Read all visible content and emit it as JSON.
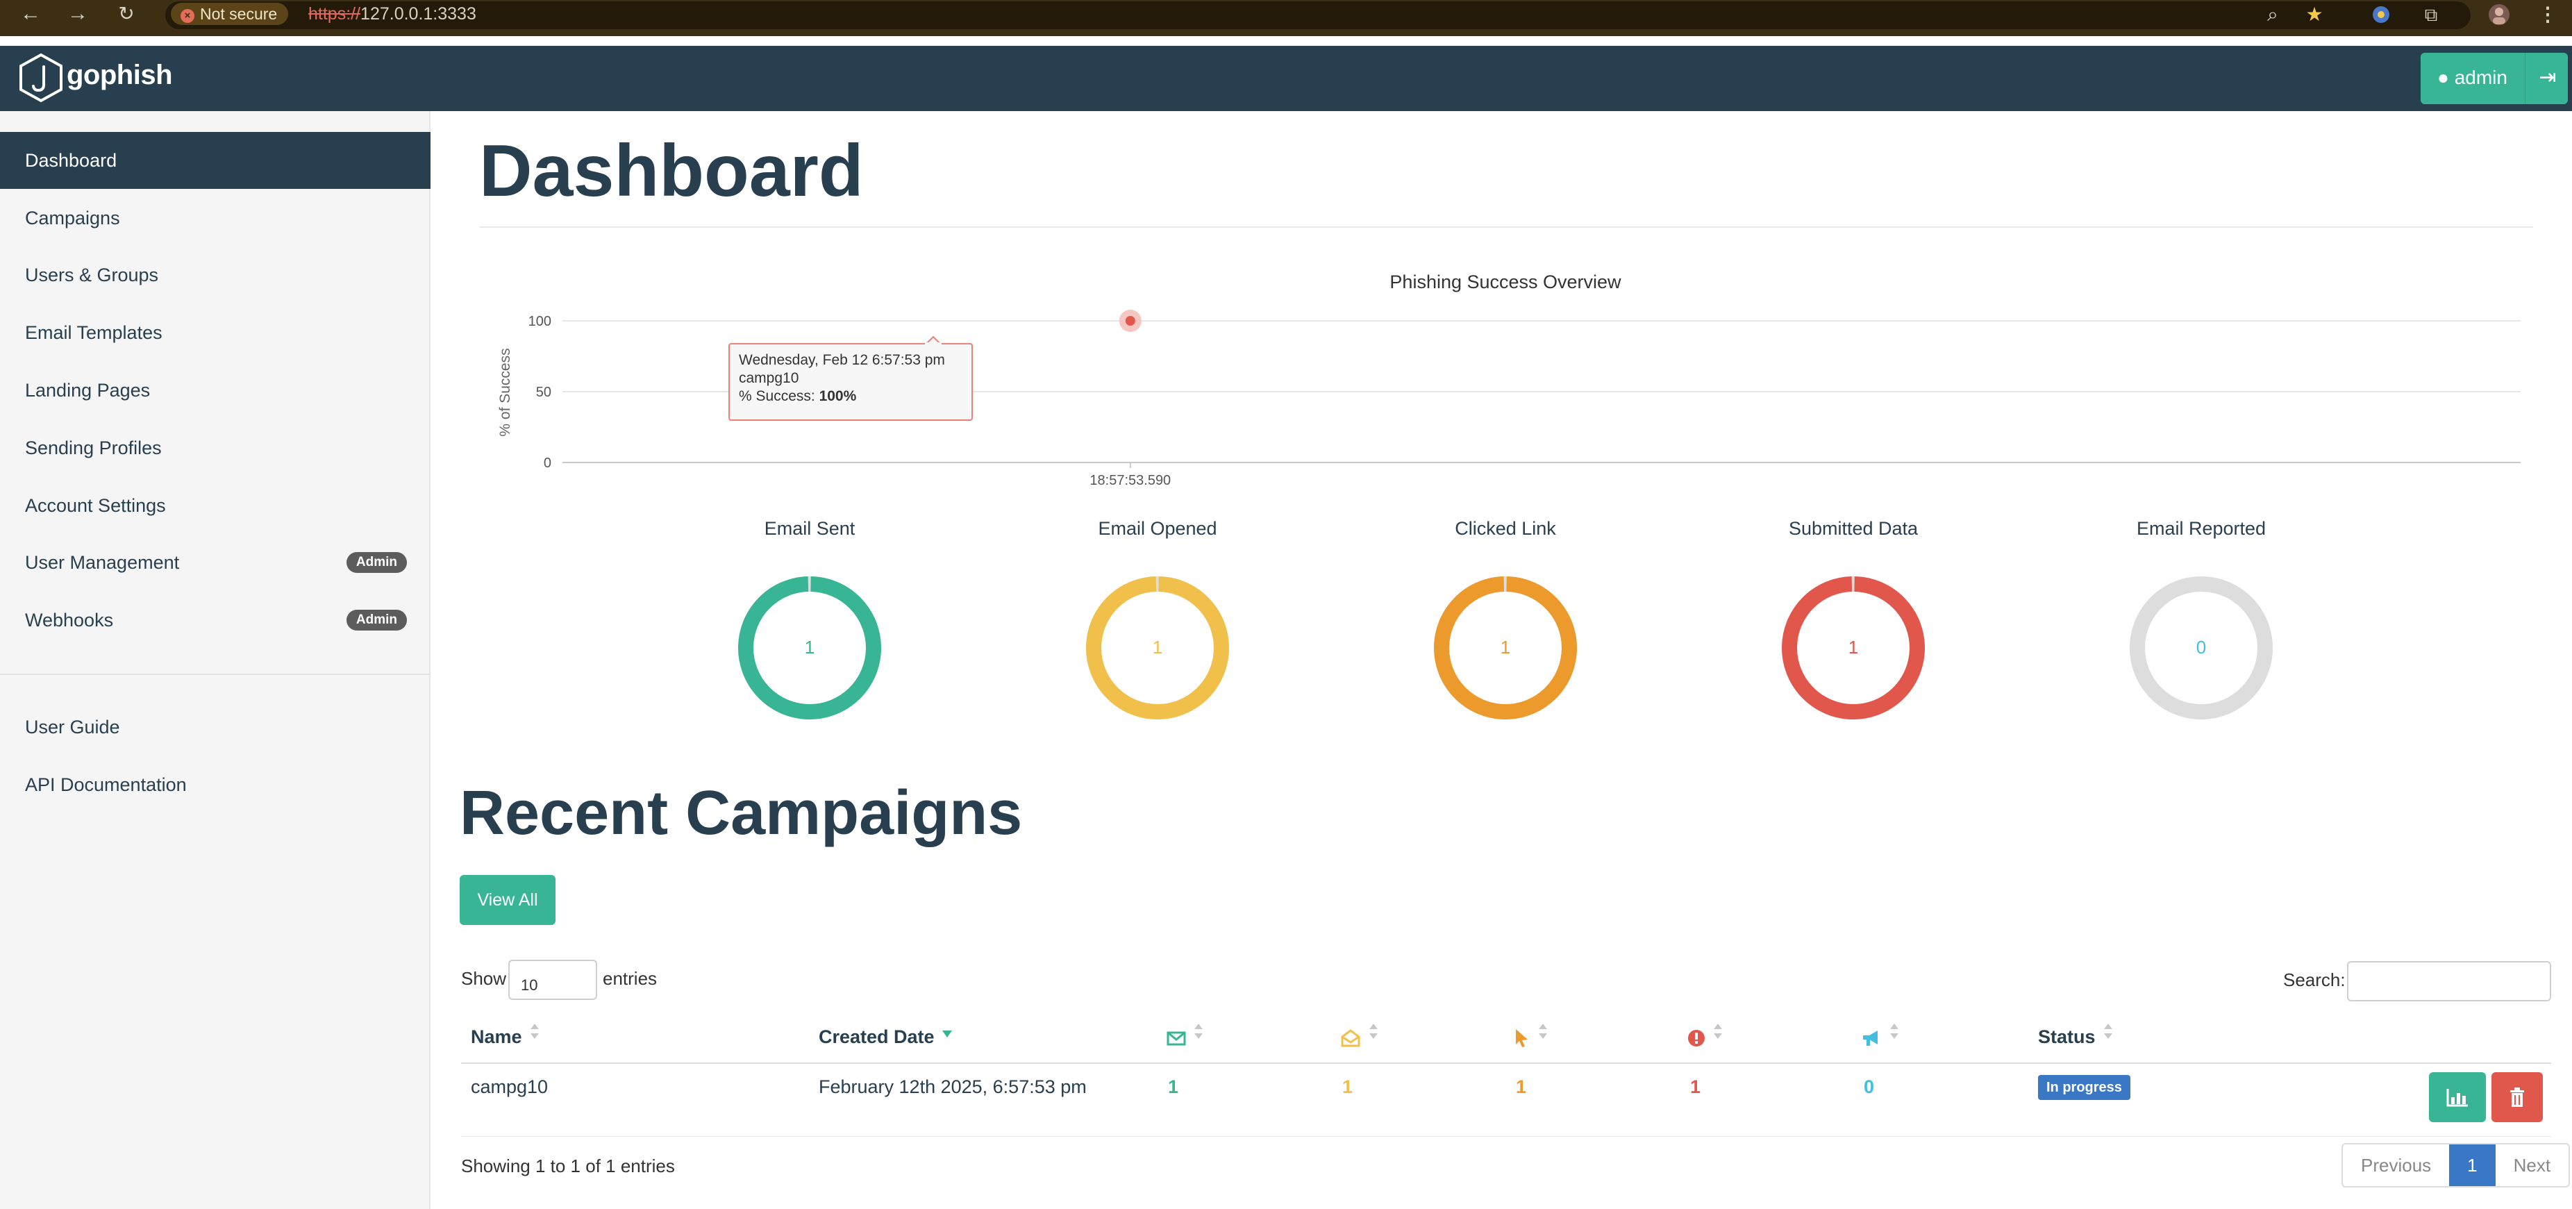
{
  "browser": {
    "security_label": "Not secure",
    "url_protocol": "https://",
    "url_host": "127.0.0.1:3333"
  },
  "navbar": {
    "brand": "gophish",
    "user_label": "admin"
  },
  "sidebar": {
    "items": [
      {
        "label": "Dashboard",
        "active": true
      },
      {
        "label": "Campaigns"
      },
      {
        "label": "Users & Groups"
      },
      {
        "label": "Email Templates"
      },
      {
        "label": "Landing Pages"
      },
      {
        "label": "Sending Profiles"
      },
      {
        "label": "Account Settings"
      },
      {
        "label": "User Management",
        "badge": "Admin"
      },
      {
        "label": "Webhooks",
        "badge": "Admin"
      }
    ],
    "secondary": [
      {
        "label": "User Guide"
      },
      {
        "label": "API Documentation"
      }
    ]
  },
  "main": {
    "title": "Dashboard",
    "recent_title": "Recent Campaigns",
    "view_all": "View All"
  },
  "chart_data": {
    "type": "line",
    "title": "Phishing Success Overview",
    "ylabel": "% of Success",
    "xlabel": "",
    "ylim": [
      0,
      100
    ],
    "yticks": [
      0,
      50,
      100
    ],
    "x_tick_labels": [
      "18:57:53.590"
    ],
    "series": [
      {
        "x": [
          "18:57:53.590"
        ],
        "values": [
          100
        ]
      }
    ],
    "tooltip": {
      "date": "Wednesday, Feb 12 6:57:53 pm",
      "campaign": "campg10",
      "label": "% Success:",
      "value": "100%"
    },
    "grid": true
  },
  "stats": [
    {
      "title": "Email Sent",
      "value": "1",
      "fraction": 1,
      "color": "#37b595"
    },
    {
      "title": "Email Opened",
      "value": "1",
      "fraction": 1,
      "color": "#f0c04a"
    },
    {
      "title": "Clicked Link",
      "value": "1",
      "fraction": 1,
      "color": "#ec9a2b"
    },
    {
      "title": "Submitted Data",
      "value": "1",
      "fraction": 1,
      "color": "#e2574c"
    },
    {
      "title": "Email Reported",
      "value": "0",
      "fraction": 0,
      "color": "#44bede"
    }
  ],
  "table": {
    "show_label": "Show",
    "entries_value": "10",
    "entries_label": "entries",
    "search_label": "Search:",
    "headers": {
      "name": "Name",
      "created": "Created Date",
      "status": "Status"
    },
    "icon_colors": {
      "sent": "#37b595",
      "opened": "#f0c04a",
      "clicked": "#ec9a2b",
      "submitted": "#e2574c",
      "reported": "#44bede"
    },
    "rows": [
      {
        "name": "campg10",
        "created": "February 12th 2025, 6:57:53 pm",
        "sent": "1",
        "opened": "1",
        "clicked": "1",
        "submitted": "1",
        "reported": "0",
        "status": "In progress"
      }
    ],
    "showing": "Showing 1 to 1 of 1 entries",
    "pager": {
      "previous": "Previous",
      "current": "1",
      "next": "Next"
    }
  }
}
